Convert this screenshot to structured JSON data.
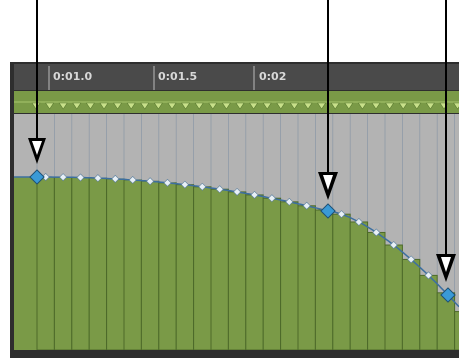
{
  "ruler": {
    "labels": [
      "0:01.0",
      "0:01.5",
      "0:02"
    ]
  },
  "automation": {
    "breakpoint_count": 3,
    "callout_count": 3
  },
  "colors": {
    "ruler_bg": "#4a4a4a",
    "lane_bg": "#b3b3b3",
    "track_green": "#7a9a47",
    "track_green_dark": "#4d6a2a",
    "marker_fill": "#c8e08a",
    "breakpoint_fill": "#3a9ad6",
    "frame_dark": "#2e2e2e",
    "callout_arrow": "#000000"
  }
}
